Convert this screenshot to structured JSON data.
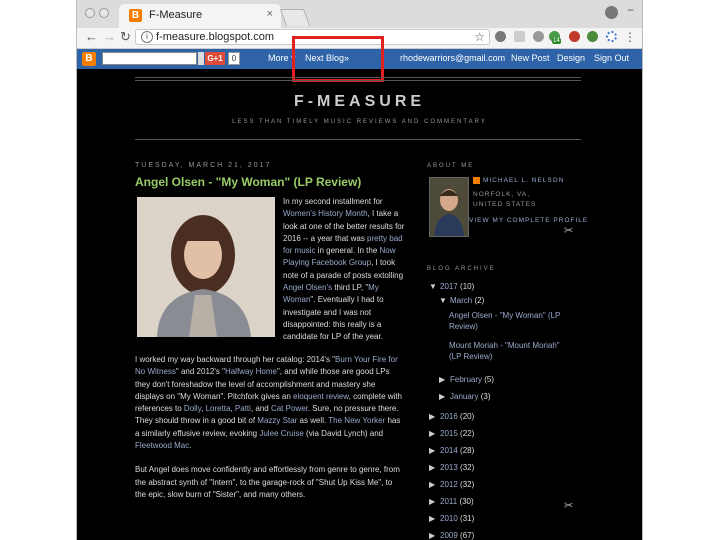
{
  "browser": {
    "tab_title": "F-Measure",
    "tab_close": "×",
    "url": "f-measure.blogspot.com",
    "icons": {
      "back": "arrow-left-icon",
      "forward": "arrow-right-icon",
      "reload": "reload-icon"
    },
    "extension_badge": "14"
  },
  "navbar": {
    "gplus_label": "G+1",
    "gplus_count": "0",
    "more": "More ▾",
    "next_blog": "Next Blog»",
    "email": "rhodewarriors@gmail.com",
    "new_post": "New Post",
    "design": "Design",
    "sign_out": "Sign Out"
  },
  "blog": {
    "title": "F-MEASURE",
    "description": "LESS THAN TIMELY MUSIC REVIEWS AND COMMENTARY"
  },
  "post": {
    "date": "TUESDAY, MARCH 21, 2017",
    "title": "Angel Olsen - \"My Woman\" (LP Review)",
    "para1": {
      "t1": "In my second installment for ",
      "l1": "Women's History Month",
      "t2": ", I take a look at one of the better results for 2016 -- a year that was ",
      "l2": "pretty bad for music",
      "t3": " in general.  In the ",
      "l3": "Now Playing Facebook Group",
      "t4": ", I took note of a parade of posts extolling ",
      "l4": "Angel Olsen's",
      "t5": " third LP, \"",
      "l5": "My Woman",
      "t6": "\".  Eventually I had to investigate and I was not disappointed: this really is a candidate for LP of the year."
    },
    "para2": {
      "t1": "I worked my way backward through her catalog: 2014's \"",
      "l1": "Burn Your Fire for No Witness",
      "t2": "\" and 2012's \"",
      "l2": "Halfway Home",
      "t3": "\", and while those are good LPs they don't foreshadow the level of accomplishment and mastery she displays on \"My Woman\".  Pitchfork gives an ",
      "l3": "eloquent review",
      "t4": ", complete with references to ",
      "l4": "Dolly",
      "t5": ", ",
      "l5": "Loretta",
      "t6": ", ",
      "l6": "Patti",
      "t7": ", and ",
      "l7": "Cat Power",
      "t8": ".  Sure, no pressure there.  They should throw in a good bit of ",
      "l8": "Mazzy Star",
      "t9": " as well.  ",
      "l9": "The New Yorker",
      "t10": " has a similarly effusive review, evoking ",
      "l10": "Julee Cruise",
      "t11": " (via David Lynch) and ",
      "l11": "Fleetwood Mac",
      "t12": "."
    },
    "para3": "But Angel does move confidently and effortlessly from genre to genre, from the abstract synth of \"Intern\", to the garage-rock of \"Shut Up Kiss Me\", to the epic, slow burn of \"Sister\", and many others."
  },
  "sidebar": {
    "about_heading": "ABOUT ME",
    "author_name": "MICHAEL L. NELSON",
    "author_location": "NORFOLK, VA, UNITED STATES",
    "profile_link": "VIEW MY COMPLETE PROFILE",
    "archive_heading": "BLOG ARCHIVE",
    "archive": {
      "y2017": {
        "label": "2017",
        "count": "(10)"
      },
      "march": {
        "label": "March",
        "count": "(2)"
      },
      "post1": "Angel Olsen - \"My Woman\" (LP Review)",
      "post2": "Mount Moriah - \"Mount Moriah\" (LP Review)",
      "february": {
        "label": "February",
        "count": "(5)"
      },
      "january": {
        "label": "January",
        "count": "(3)"
      },
      "years": [
        {
          "label": "2016",
          "count": "(20)"
        },
        {
          "label": "2015",
          "count": "(22)"
        },
        {
          "label": "2014",
          "count": "(28)"
        },
        {
          "label": "2013",
          "count": "(32)"
        },
        {
          "label": "2012",
          "count": "(32)"
        },
        {
          "label": "2011",
          "count": "(30)"
        },
        {
          "label": "2010",
          "count": "(31)"
        },
        {
          "label": "2009",
          "count": "(67)"
        }
      ]
    }
  },
  "colors": {
    "highlight": "#e32020",
    "navbar": "#2e63a8",
    "link": "#99aacc",
    "post_title": "#99cc66",
    "background": "#000000"
  }
}
